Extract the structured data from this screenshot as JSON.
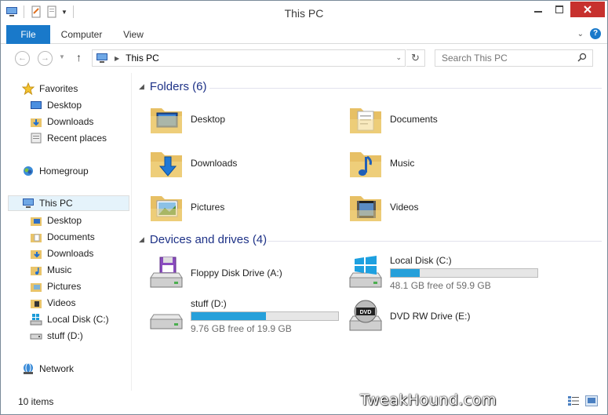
{
  "window": {
    "title": "This PC"
  },
  "ribbon": {
    "tabs": [
      "File",
      "Computer",
      "View"
    ]
  },
  "address": {
    "crumb": "This PC"
  },
  "search": {
    "placeholder": "Search This PC"
  },
  "nav": {
    "favorites": {
      "label": "Favorites",
      "items": [
        "Desktop",
        "Downloads",
        "Recent places"
      ]
    },
    "homegroup": "Homegroup",
    "thispc": {
      "label": "This PC",
      "items": [
        "Desktop",
        "Documents",
        "Downloads",
        "Music",
        "Pictures",
        "Videos",
        "Local Disk (C:)",
        "stuff (D:)"
      ]
    },
    "network": "Network"
  },
  "folders": {
    "header": "Folders (6)",
    "items": [
      "Desktop",
      "Documents",
      "Downloads",
      "Music",
      "Pictures",
      "Videos"
    ]
  },
  "devices": {
    "header": "Devices and drives (4)",
    "items": [
      {
        "name": "Floppy Disk Drive (A:)"
      },
      {
        "name": "Local Disk (C:)",
        "free_text": "48.1 GB free of 59.9 GB",
        "used_fraction": 0.197
      },
      {
        "name": "stuff (D:)",
        "free_text": "9.76 GB free of 19.9 GB",
        "used_fraction": 0.51
      },
      {
        "name": "DVD RW Drive (E:)"
      }
    ]
  },
  "status": {
    "count": "10 items"
  },
  "watermark": "TweakHound.com",
  "colors": {
    "accent": "#1979ca",
    "close": "#c7312e",
    "bar_fill": "#26a0da",
    "group_header": "#1e3287"
  }
}
